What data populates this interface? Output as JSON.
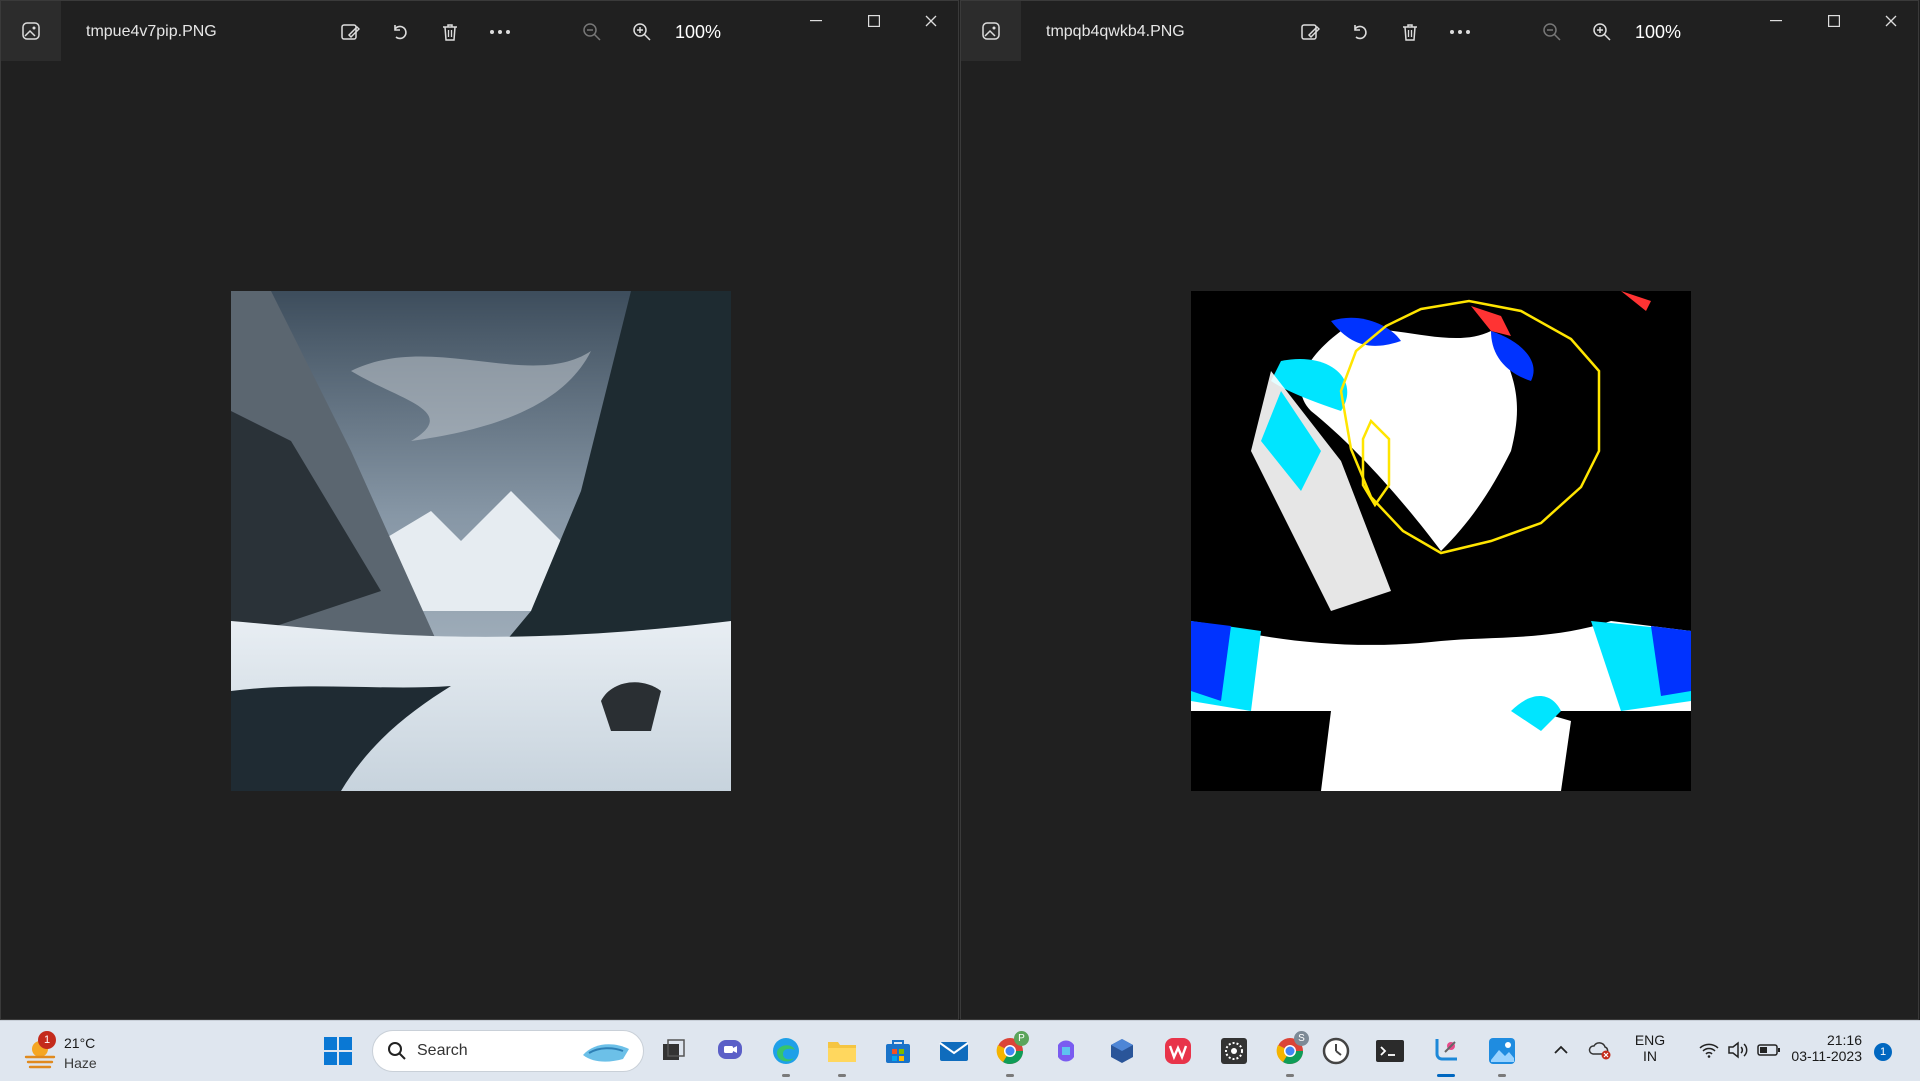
{
  "windows": [
    {
      "filename": "tmpue4v7pip.PNG",
      "zoom": "100%"
    },
    {
      "filename": "tmpqb4qwkb4.PNG",
      "zoom": "100%"
    }
  ],
  "taskbar": {
    "weather": {
      "temp": "21°C",
      "condition": "Haze",
      "badge": "1"
    },
    "search_label": "Search",
    "apps": [
      "start-icon",
      "task-view-icon",
      "chat-icon",
      "edge-icon",
      "file-explorer-icon",
      "store-icon",
      "mail-icon",
      "chrome-profile-p-icon",
      "copilot-icon",
      "virtualbox-icon",
      "wps-icon",
      "settings-app-icon",
      "chrome-profile-s-icon",
      "clock-app-icon",
      "terminal-icon",
      "snipping-tool-icon",
      "photos-icon"
    ],
    "chrome_badges": {
      "p": "P",
      "s": "S"
    },
    "language": {
      "line1": "ENG",
      "line2": "IN"
    },
    "clock": {
      "time": "21:16",
      "date": "03-11-2023"
    },
    "notification_count": "1"
  },
  "colors": {
    "accent": "#0067c0",
    "window_bg": "#202020",
    "taskbar_bg": "#dfe6ef",
    "overlay_yellow": "#ffe500"
  }
}
